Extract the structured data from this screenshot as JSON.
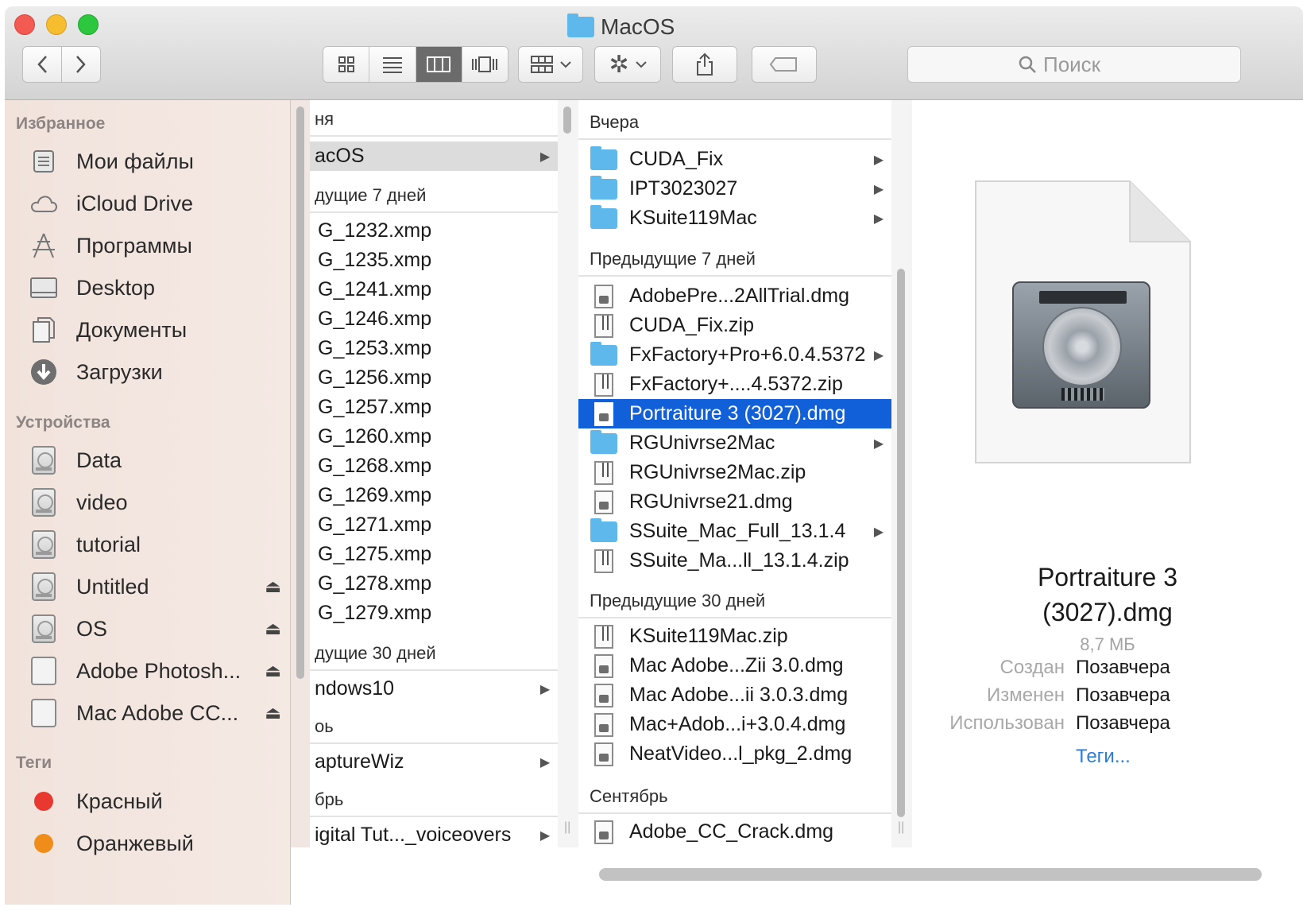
{
  "window": {
    "title": "MacOS"
  },
  "toolbar": {
    "back_icon": "chevron-left-icon",
    "forward_icon": "chevron-right-icon",
    "views": [
      "icon-view-icon",
      "list-view-icon",
      "column-view-icon",
      "coverflow-view-icon"
    ],
    "active_view": 2,
    "search_placeholder": "Поиск"
  },
  "sidebar": {
    "favorites_header": "Избранное",
    "favorites": [
      {
        "label": "Мои файлы",
        "icon": "all-files-icon"
      },
      {
        "label": "iCloud Drive",
        "icon": "cloud-icon"
      },
      {
        "label": "Программы",
        "icon": "applications-icon"
      },
      {
        "label": "Desktop",
        "icon": "desktop-icon"
      },
      {
        "label": "Документы",
        "icon": "documents-icon"
      },
      {
        "label": "Загрузки",
        "icon": "downloads-icon"
      }
    ],
    "devices_header": "Устройства",
    "devices": [
      {
        "label": "Data",
        "eject": false
      },
      {
        "label": "video",
        "eject": false
      },
      {
        "label": "tutorial",
        "eject": false
      },
      {
        "label": "Untitled",
        "eject": true
      },
      {
        "label": "OS",
        "eject": true
      },
      {
        "label": "Adobe Photosh...",
        "eject": true
      },
      {
        "label": "Mac Adobe CC...",
        "eject": true
      }
    ],
    "tags_header": "Теги",
    "tags": [
      {
        "label": "Красный",
        "color": "#e8382f"
      },
      {
        "label": "Оранжевый",
        "color": "#f08c1a"
      }
    ]
  },
  "column1": {
    "group_today": "ня",
    "selected_folder": "acOS",
    "group_7days": "дущие 7 дней",
    "xmp_files": [
      "G_1232.xmp",
      "G_1235.xmp",
      "G_1241.xmp",
      "G_1246.xmp",
      "G_1253.xmp",
      "G_1256.xmp",
      "G_1257.xmp",
      "G_1260.xmp",
      "G_1268.xmp",
      "G_1269.xmp",
      "G_1271.xmp",
      "G_1275.xmp",
      "G_1278.xmp",
      "G_1279.xmp"
    ],
    "group_30days": "дущие 30 дней",
    "windows_folder": "ndows10",
    "group_month1": "оь",
    "capture_folder": "aptureWiz",
    "group_month2": "брь",
    "tutorial_folder": "igital Tut..._voiceovers"
  },
  "column2": {
    "group_yesterday": "Вчера",
    "yesterday": [
      {
        "name": "CUDA_Fix",
        "type": "folder"
      },
      {
        "name": "IPT3023027",
        "type": "folder"
      },
      {
        "name": "KSuite119Mac",
        "type": "folder"
      }
    ],
    "group_7days": "Предыдущие 7 дней",
    "week": [
      {
        "name": "AdobePre...2AllTrial.dmg",
        "type": "dmg"
      },
      {
        "name": "CUDA_Fix.zip",
        "type": "zip"
      },
      {
        "name": "FxFactory+Pro+6.0.4.5372",
        "type": "folder"
      },
      {
        "name": "FxFactory+....4.5372.zip",
        "type": "zip"
      },
      {
        "name": "Portraiture 3 (3027).dmg",
        "type": "dmg",
        "selected": true
      },
      {
        "name": "RGUnivrse2Mac",
        "type": "folder"
      },
      {
        "name": "RGUnivrse2Mac.zip",
        "type": "zip"
      },
      {
        "name": "RGUnivrse21.dmg",
        "type": "dmg"
      },
      {
        "name": "SSuite_Mac_Full_13.1.4",
        "type": "folder"
      },
      {
        "name": "SSuite_Ma...ll_13.1.4.zip",
        "type": "zip"
      }
    ],
    "group_30days": "Предыдущие 30 дней",
    "month": [
      {
        "name": "KSuite119Mac.zip",
        "type": "zip"
      },
      {
        "name": "Mac Adobe...Zii 3.0.dmg",
        "type": "dmg"
      },
      {
        "name": "Mac Adobe...ii 3.0.3.dmg",
        "type": "dmg"
      },
      {
        "name": "Mac+Adob...i+3.0.4.dmg",
        "type": "dmg"
      },
      {
        "name": "NeatVideo...l_pkg_2.dmg",
        "type": "dmg"
      }
    ],
    "group_september": "Сентябрь",
    "september": [
      {
        "name": "Adobe_CC_Crack.dmg",
        "type": "dmg"
      }
    ]
  },
  "preview": {
    "name_line1": "Portraiture 3",
    "name_line2": "(3027).dmg",
    "size": "8,7 МБ",
    "created_label": "Создан",
    "created_value": "Позавчера",
    "modified_label": "Изменен",
    "modified_value": "Позавчера",
    "used_label": "Использован",
    "used_value": "Позавчера",
    "tags_link": "Теги..."
  }
}
